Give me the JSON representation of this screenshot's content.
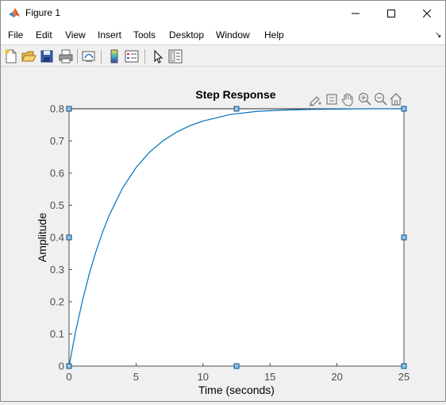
{
  "window": {
    "title": "Figure 1",
    "controls": {
      "minimize": "minimize",
      "maximize": "maximize",
      "close": "close"
    }
  },
  "menu": [
    "File",
    "Edit",
    "View",
    "Insert",
    "Tools",
    "Desktop",
    "Window",
    "Help"
  ],
  "toolbar_icons": [
    "new-figure-icon",
    "open-file-icon",
    "save-icon",
    "print-icon",
    "link-plot-icon",
    "insert-colorbar-icon",
    "insert-legend-icon",
    "edit-plot-icon",
    "property-inspector-icon"
  ],
  "axes_toolbar_icons": [
    "brush-icon",
    "datatip-icon",
    "pan-icon",
    "zoom-in-icon",
    "zoom-out-icon",
    "home-icon"
  ],
  "colors": {
    "line": "#0072bd",
    "handle_fill": "#8fc3e8",
    "handle_stroke": "#0b4f86"
  },
  "chart_data": {
    "type": "line",
    "title": "Step Response",
    "xlabel": "Time (seconds)",
    "ylabel": "Amplitude",
    "xlim": [
      0,
      25
    ],
    "ylim": [
      0,
      0.8
    ],
    "xticks": [
      "0",
      "5",
      "10",
      "15",
      "20",
      "25"
    ],
    "yticks": [
      "0",
      "0.1",
      "0.2",
      "0.3",
      "0.4",
      "0.5",
      "0.6",
      "0.7",
      "0.8"
    ],
    "grid": false,
    "series": [
      {
        "x": [
          0,
          0.5,
          1,
          1.5,
          2,
          2.5,
          3,
          4,
          5,
          6,
          7,
          8,
          9,
          10,
          12,
          14,
          16,
          18,
          20,
          22,
          25
        ],
        "y": [
          0,
          0.109,
          0.203,
          0.285,
          0.355,
          0.416,
          0.469,
          0.554,
          0.617,
          0.665,
          0.7,
          0.727,
          0.747,
          0.762,
          0.782,
          0.792,
          0.796,
          0.798,
          0.799,
          0.8,
          0.8
        ]
      }
    ],
    "steady_state": 0.8
  }
}
